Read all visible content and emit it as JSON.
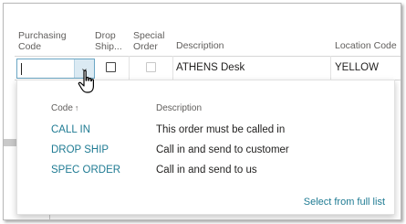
{
  "columns": {
    "purchasing_code": "Purchasing Code",
    "drop_ship": "Drop Ship...",
    "special_order": "Special Order",
    "description": "Description",
    "location_code": "Location Code"
  },
  "row": {
    "purchasing_code_value": "",
    "drop_ship_checked": false,
    "special_order_checked": false,
    "description": "ATHENS Desk",
    "location_code": "YELLOW"
  },
  "dropdown": {
    "col_code": "Code",
    "col_code_sort_icon": "sort-ascending-icon",
    "col_description": "Description",
    "items": [
      {
        "code": "CALL IN",
        "description": "This order must be called in"
      },
      {
        "code": "DROP SHIP",
        "description": "Call in and send to customer"
      },
      {
        "code": "SPEC ORDER",
        "description": "Call in and send to us"
      }
    ],
    "select_full_list": "Select from full list"
  },
  "colors": {
    "link": "#1f7b93",
    "header_text": "#605e5c",
    "body_text": "#201f1e",
    "dropdown_button": "#dbeaf3",
    "input_border": "#6aa6c4"
  }
}
